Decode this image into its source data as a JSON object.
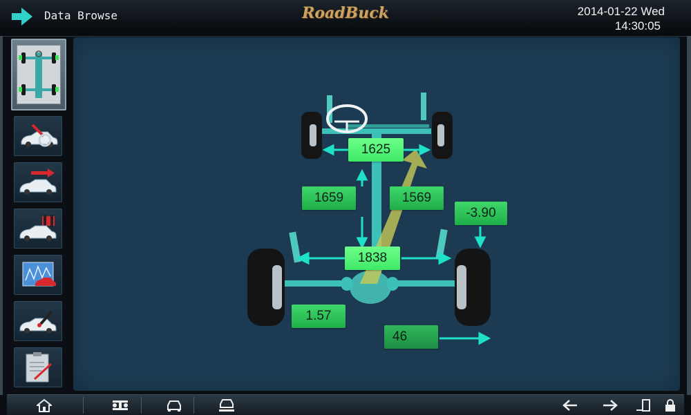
{
  "header": {
    "title": "Data Browse",
    "brand": "RoadBuck",
    "date": "2014-01-22 Wed",
    "time": "14:30:05"
  },
  "sidebar": {
    "items": [
      {
        "icon": "chassis-overview-icon",
        "active": true
      },
      {
        "icon": "car-inspection-icon",
        "active": false
      },
      {
        "icon": "car-direction-icon",
        "active": false
      },
      {
        "icon": "car-alignment-icon",
        "active": false
      },
      {
        "icon": "car-data-chart-icon",
        "active": false
      },
      {
        "icon": "car-adjust-icon",
        "active": false
      },
      {
        "icon": "report-clipboard-icon",
        "active": false
      }
    ]
  },
  "measurements": {
    "front_track": "1625",
    "left_wheelbase": "1659",
    "right_wheelbase": "1569",
    "rear_track": "1838",
    "setback": "-3.90",
    "rear_value": "1.57",
    "offset": "46"
  },
  "footer": {
    "icons": [
      "home-icon",
      "lift-icon",
      "car-front-icon",
      "car-front-lift-icon",
      "arrow-left-icon",
      "arrow-right-icon",
      "exit-icon",
      "lock-icon"
    ]
  },
  "colors": {
    "panel": "#1c3b52",
    "label_green": "#2fc45a",
    "arrow_cyan": "#1fe0c8",
    "axle_teal": "#3cc0b8"
  }
}
